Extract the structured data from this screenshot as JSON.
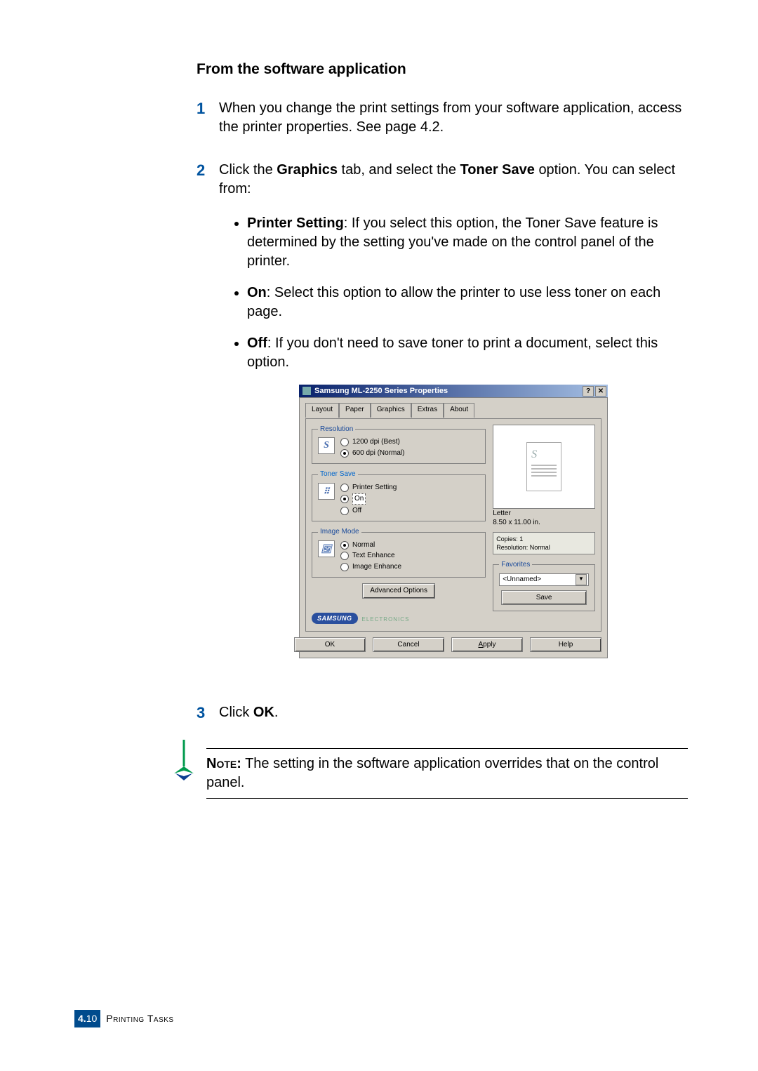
{
  "section_title": "From the software application",
  "steps": {
    "1": "When you change the print settings from your software application, access the printer properties. See page 4.2.",
    "2": {
      "lead_a": "Click the ",
      "lead_b": " tab, and select the ",
      "lead_c": " option. You can select from:",
      "graphics_word": "Graphics",
      "tonersave_word": "Toner Save",
      "bullets": {
        "printer_setting_label": "Printer Setting",
        "printer_setting_text": ": If you select this option, the Toner Save feature is determined by the setting you've made on the control panel of the printer.",
        "on_label": "On",
        "on_text": ": Select this option to allow the printer to use less toner on each page.",
        "off_label": "Off",
        "off_text": ": If you don't need to save toner to print a document, select this option."
      }
    },
    "3": {
      "lead": "Click ",
      "ok_word": "OK",
      "tail": "."
    }
  },
  "note": {
    "label": "Note:",
    "text": " The setting in the software application overrides that on the control panel."
  },
  "dialog": {
    "title": "Samsung ML-2250 Series Properties",
    "winbtns": {
      "help": "?",
      "close": "✕"
    },
    "tabs": [
      "Layout",
      "Paper",
      "Graphics",
      "Extras",
      "About"
    ],
    "active_tab_index": 2,
    "resolution": {
      "legend": "Resolution",
      "options": [
        "1200 dpi (Best)",
        "600 dpi (Normal)"
      ],
      "selected_index": 1
    },
    "toner_save": {
      "legend": "Toner Save",
      "options": [
        "Printer Setting",
        "On",
        "Off"
      ],
      "selected_index": 1
    },
    "image_mode": {
      "legend": "Image Mode",
      "options": [
        "Normal",
        "Text Enhance",
        "Image Enhance"
      ],
      "selected_index": 0
    },
    "adv_btn": "Advanced Options",
    "preview": {
      "paper_name": "Letter",
      "paper_size": "8.50 x 11.00 in."
    },
    "status": {
      "copies": "Copies: 1",
      "resolution": "Resolution: Normal"
    },
    "favorites": {
      "legend": "Favorites",
      "selected": "<Unnamed>",
      "save_btn": "Save"
    },
    "brand": {
      "logo": "SAMSUNG",
      "sub": "ELECTRONICS"
    },
    "buttons": {
      "ok": "OK",
      "cancel": "Cancel",
      "apply": "Apply",
      "help": "Help"
    }
  },
  "footer": {
    "chapter": "4.",
    "page": "10",
    "title": "Printing Tasks"
  }
}
